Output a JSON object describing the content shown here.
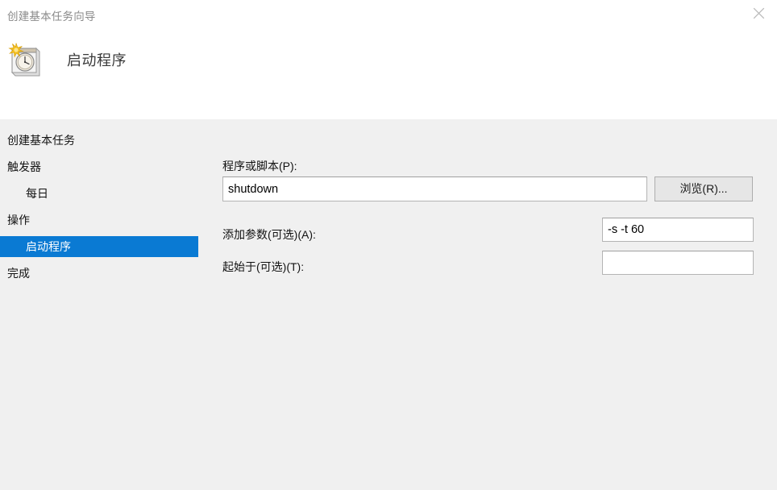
{
  "window": {
    "title": "创建基本任务向导",
    "close_icon": "close-icon"
  },
  "page": {
    "heading": "启动程序",
    "heading_icon": "task-scheduler-calendar-clock-icon"
  },
  "nav": {
    "items": [
      {
        "label": "创建基本任务",
        "level": 0,
        "selected": false
      },
      {
        "label": "触发器",
        "level": 0,
        "selected": false
      },
      {
        "label": "每日",
        "level": 1,
        "selected": false
      },
      {
        "label": "操作",
        "level": 0,
        "selected": false
      },
      {
        "label": "启动程序",
        "level": 1,
        "selected": true
      },
      {
        "label": "完成",
        "level": 0,
        "selected": false
      }
    ]
  },
  "form": {
    "program_label": "程序或脚本(P):",
    "program_value": "shutdown",
    "program_placeholder": "",
    "browse_label": "浏览(R)...",
    "arguments_label": "添加参数(可选)(A):",
    "arguments_value": "-s -t 60",
    "arguments_placeholder": "",
    "start_in_label": "起始于(可选)(T):",
    "start_in_value": "",
    "start_in_placeholder": ""
  },
  "colors": {
    "selection_blue": "#0a7ad3",
    "body_gray": "#f0f0f0",
    "header_white": "#ffffff",
    "title_gray": "#8a8a8a",
    "button_face": "#e6e6e6"
  }
}
